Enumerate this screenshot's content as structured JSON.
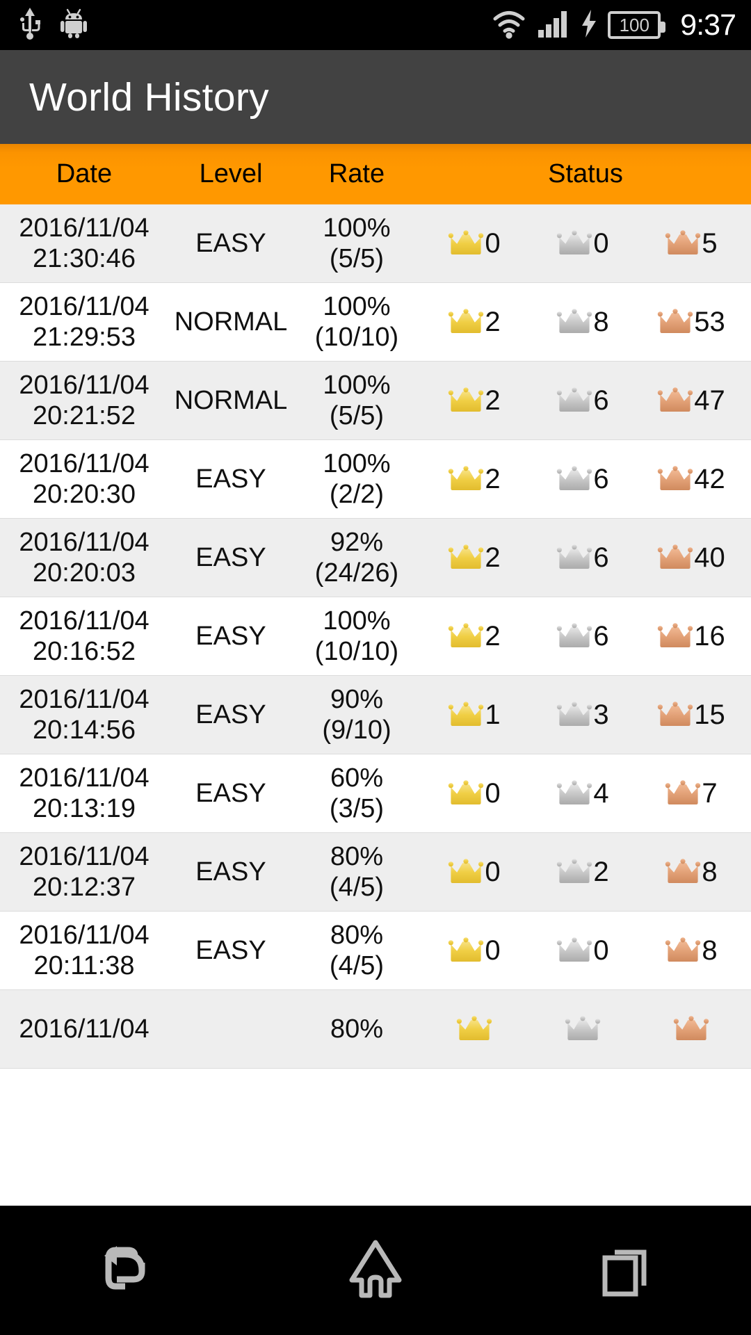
{
  "status_bar": {
    "time": "9:37",
    "battery_level": "100",
    "icons": [
      "usb-icon",
      "android-robot-icon",
      "wifi-icon",
      "cellular-signal-icon",
      "charging-bolt-icon",
      "battery-icon"
    ]
  },
  "app_bar": {
    "title": "World History"
  },
  "table": {
    "headers": {
      "date": "Date",
      "level": "Level",
      "rate": "Rate",
      "status": "Status"
    },
    "accent_color": "#ff9800",
    "rows": [
      {
        "date": "2016/11/04",
        "time": "21:30:46",
        "level": "EASY",
        "rate_pct": "100%",
        "rate_frac": "(5/5)",
        "gold": "0",
        "silver": "0",
        "bronze": "5"
      },
      {
        "date": "2016/11/04",
        "time": "21:29:53",
        "level": "NORMAL",
        "rate_pct": "100%",
        "rate_frac": "(10/10)",
        "gold": "2",
        "silver": "8",
        "bronze": "53"
      },
      {
        "date": "2016/11/04",
        "time": "20:21:52",
        "level": "NORMAL",
        "rate_pct": "100%",
        "rate_frac": "(5/5)",
        "gold": "2",
        "silver": "6",
        "bronze": "47"
      },
      {
        "date": "2016/11/04",
        "time": "20:20:30",
        "level": "EASY",
        "rate_pct": "100%",
        "rate_frac": "(2/2)",
        "gold": "2",
        "silver": "6",
        "bronze": "42"
      },
      {
        "date": "2016/11/04",
        "time": "20:20:03",
        "level": "EASY",
        "rate_pct": "92%",
        "rate_frac": "(24/26)",
        "gold": "2",
        "silver": "6",
        "bronze": "40"
      },
      {
        "date": "2016/11/04",
        "time": "20:16:52",
        "level": "EASY",
        "rate_pct": "100%",
        "rate_frac": "(10/10)",
        "gold": "2",
        "silver": "6",
        "bronze": "16"
      },
      {
        "date": "2016/11/04",
        "time": "20:14:56",
        "level": "EASY",
        "rate_pct": "90%",
        "rate_frac": "(9/10)",
        "gold": "1",
        "silver": "3",
        "bronze": "15"
      },
      {
        "date": "2016/11/04",
        "time": "20:13:19",
        "level": "EASY",
        "rate_pct": "60%",
        "rate_frac": "(3/5)",
        "gold": "0",
        "silver": "4",
        "bronze": "7"
      },
      {
        "date": "2016/11/04",
        "time": "20:12:37",
        "level": "EASY",
        "rate_pct": "80%",
        "rate_frac": "(4/5)",
        "gold": "0",
        "silver": "2",
        "bronze": "8"
      },
      {
        "date": "2016/11/04",
        "time": "20:11:38",
        "level": "EASY",
        "rate_pct": "80%",
        "rate_frac": "(4/5)",
        "gold": "0",
        "silver": "0",
        "bronze": "8"
      },
      {
        "date": "2016/11/04",
        "time": "",
        "level": "",
        "rate_pct": "80%",
        "rate_frac": "",
        "gold": "",
        "silver": "",
        "bronze": ""
      }
    ],
    "medal_colors": {
      "gold": "#f2d044",
      "silver": "#c4c4c4",
      "bronze": "#e09a71"
    }
  },
  "nav_bar": {
    "buttons": [
      "back-button",
      "home-button",
      "recents-button"
    ]
  }
}
